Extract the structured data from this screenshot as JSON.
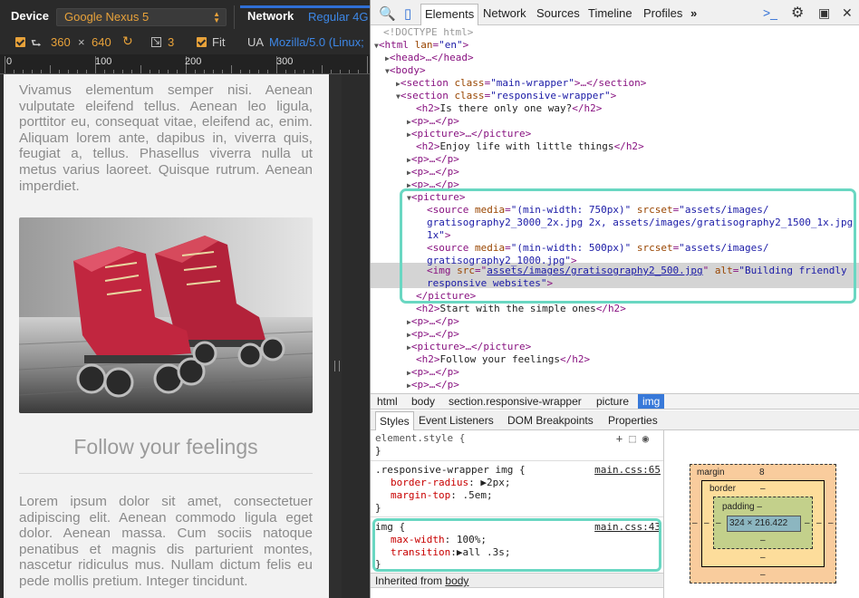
{
  "device_bar": {
    "device_label": "Device",
    "device_value": "Google Nexus 5",
    "network_label": "Network",
    "network_value": "Regular 4G",
    "width": "360",
    "times": "×",
    "height": "640",
    "scale": "3",
    "fit_label": "Fit",
    "ua_label": "UA",
    "ua_value": "Mozilla/5.0 (Linux;"
  },
  "ruler": [
    "0",
    "100",
    "200",
    "300"
  ],
  "page": {
    "para1": "Vivamus elementum semper nisi. Aenean vulputate eleifend tellus. Aenean leo ligula, porttitor eu, consequat vitae, eleifend ac, enim. Aliquam lorem ante, dapibus in, viverra quis, feugiat a, tellus. Phasellus viverra nulla ut metus varius laoreet. Quisque rutrum. Aenean imperdiet.",
    "heading": "Follow your feelings",
    "para2": "Lorem ipsum dolor sit amet, consectetuer adipiscing elit. Aenean commodo ligula eget dolor. Aenean massa. Cum sociis natoque penatibus et magnis dis parturient montes, nascetur ridiculus mus. Nullam dictum felis eu pede mollis pretium. Integer tincidunt."
  },
  "devtools_tabs": [
    "Elements",
    "Network",
    "Sources",
    "Timeline",
    "Profiles",
    "»"
  ],
  "dom": {
    "doctype": "<!DOCTYPE html>",
    "html_open": "html",
    "lang_attr": "lan",
    "lang_val": "\"en\"",
    "head": "head",
    "head_mid": "…</",
    "body": "body",
    "section": "section",
    "class_attr": "class",
    "main_wrapper": "\"main-wrapper\"",
    "ellipsis_close": "…</",
    "responsive_wrapper": "\"responsive-wrapper\"",
    "h2": "h2",
    "h2_text1": "Is there only one way?",
    "h2_text2": "Enjoy life with little things",
    "h2_text3": "Start with the simple ones",
    "h2_text4": "Follow your feelings",
    "p": "p",
    "picture": "picture",
    "source": "source",
    "img": "img",
    "media_attr": "media",
    "srcset_attr": "srcset",
    "media1": "\"(min-width: 750px)\"",
    "srcset1_a": "\"assets/images/",
    "srcset1_b": "gratisography2_3000_2x.jpg 2x, assets/images/gratisography2_1500_1x.jpg",
    "srcset1_c": "1x\"",
    "media2": "\"(min-width: 500px)\"",
    "srcset2_a": "\"assets/images/",
    "srcset2_b": "gratisography2_1000.jpg\"",
    "src_attr": "src",
    "src_val": "assets/images/gratisography2_500.jpg",
    "alt_attr": "alt",
    "alt_val_a": "\"Building friendly",
    "alt_val_b": "responsive websites\""
  },
  "breadcrumbs": [
    "html",
    "body",
    "section.responsive-wrapper",
    "picture",
    "img"
  ],
  "styles_tabs": [
    "Styles",
    "Event Listeners",
    "DOM Breakpoints",
    "Properties"
  ],
  "styles": {
    "element_style": "element.style {",
    "close": "}",
    "rule1_selector": ".responsive-wrapper img {",
    "rule1_source": "main.css:65",
    "rule1_p1_name": "border-radius",
    "rule1_p1_val": "2px;",
    "rule1_p2_name": "margin-top",
    "rule1_p2_val": ".5em;",
    "rule2_selector": "img {",
    "rule2_source": "main.css:43",
    "rule2_p1_name": "max-width",
    "rule2_p1_val": "100%;",
    "rule2_p2_name": "transition",
    "rule2_p2_val": "all .3s;",
    "inherited_label": "Inherited from",
    "inherited_from": "body"
  },
  "metrics": {
    "margin_label": "margin",
    "margin_value": "8",
    "border_label": "border",
    "border_value": "–",
    "padding_label": "padding –",
    "content": "324 × 216.422",
    "dash": "–"
  },
  "colors": {
    "accent_orange": "#e8a23a",
    "accent_blue": "#3879d9",
    "highlight_teal": "#6ad7c2",
    "margin_fill": "#f9cc9d",
    "border_fill": "#fddd9b",
    "padding_fill": "#c3d08b",
    "content_fill": "#8cb6c0"
  }
}
